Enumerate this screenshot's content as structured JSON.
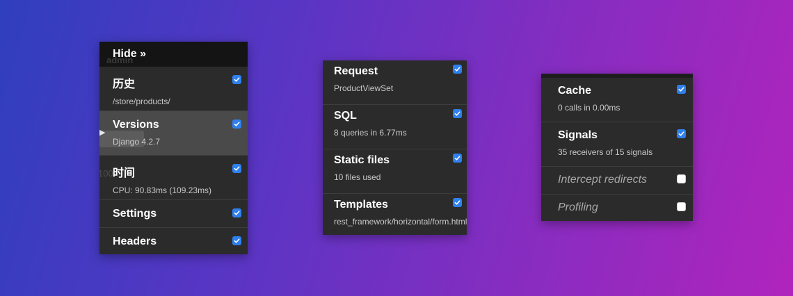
{
  "colors": {
    "panel_background": "#2b2b2b",
    "hide_bar_background": "#141414",
    "checkbox_checked": "#2f80ed",
    "highlight_row": "#4a4a4a"
  },
  "panel_1": {
    "hide_label": "Hide »",
    "background_ghost": {
      "admin_text": "admin",
      "count_text": "100"
    },
    "items": [
      {
        "title": "历史",
        "subtitle": "/store/products/",
        "checked": true
      },
      {
        "title": "Versions",
        "subtitle": "Django 4.2.7",
        "checked": true,
        "highlighted": true
      },
      {
        "title": "时间",
        "subtitle": "CPU: 90.83ms (109.23ms)",
        "checked": true
      },
      {
        "title": "Settings",
        "checked": true
      },
      {
        "title": "Headers",
        "checked": true
      }
    ]
  },
  "panel_2": {
    "items": [
      {
        "title": "Request",
        "subtitle": "ProductViewSet",
        "checked": true
      },
      {
        "title": "SQL",
        "subtitle": "8 queries in 6.77ms",
        "checked": true
      },
      {
        "title": "Static files",
        "subtitle": "10 files used",
        "checked": true
      },
      {
        "title": "Templates",
        "subtitle": "rest_framework/horizontal/form.html",
        "checked": true
      }
    ]
  },
  "panel_3": {
    "items": [
      {
        "title": "Cache",
        "subtitle": "0 calls in 0.00ms",
        "checked": true
      },
      {
        "title": "Signals",
        "subtitle": "35 receivers of 15 signals",
        "checked": true
      },
      {
        "title": "Intercept redirects",
        "checked": false
      },
      {
        "title": "Profiling",
        "checked": false
      }
    ]
  }
}
